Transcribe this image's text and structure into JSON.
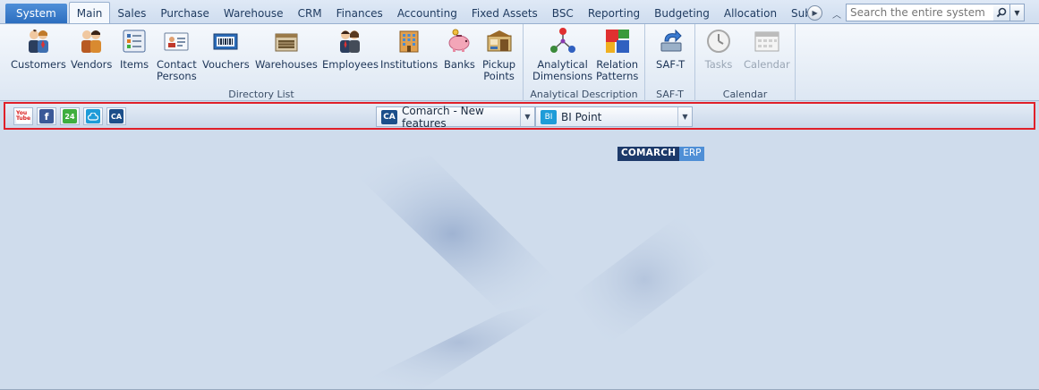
{
  "tabs": [
    {
      "label": "System",
      "kind": "system"
    },
    {
      "label": "Main",
      "kind": "active"
    },
    {
      "label": "Sales"
    },
    {
      "label": "Purchase"
    },
    {
      "label": "Warehouse"
    },
    {
      "label": "CRM"
    },
    {
      "label": "Finances"
    },
    {
      "label": "Accounting"
    },
    {
      "label": "Fixed Assets"
    },
    {
      "label": "BSC"
    },
    {
      "label": "Reporting"
    },
    {
      "label": "Budgeting"
    },
    {
      "label": "Allocation"
    },
    {
      "label": "Sub"
    }
  ],
  "search": {
    "placeholder": "Search the entire system"
  },
  "help_label": "?",
  "ribbon": {
    "directory": {
      "label": "Directory List",
      "buttons": [
        "Customers",
        "Vendors",
        "Items",
        "Contact\nPersons",
        "Vouchers",
        "Warehouses",
        "Employees",
        "Institutions",
        "Banks",
        "Pickup\nPoints"
      ]
    },
    "analytical": {
      "label": "Analytical Description",
      "buttons": [
        "Analytical\nDimensions",
        "Relation\nPatterns"
      ]
    },
    "saft": {
      "label": "SAF-T",
      "buttons": [
        "SAF-T"
      ]
    },
    "calendar": {
      "label": "Calendar",
      "buttons": [
        "Tasks",
        "Calendar"
      ]
    }
  },
  "quick": {
    "icons": [
      {
        "name": "youtube",
        "text": "You Tube",
        "color": "#d81e1e"
      },
      {
        "name": "facebook",
        "text": "f",
        "color": "#3b5998"
      },
      {
        "name": "comarch24",
        "text": "24",
        "color": "#3fae3f"
      },
      {
        "name": "cloud",
        "text": "",
        "color": "#1e9cd8"
      },
      {
        "name": "ca",
        "text": "CA",
        "color": "#1c4f8a"
      }
    ],
    "combo1": {
      "badge": "CA",
      "text": "Comarch - New features"
    },
    "combo2": {
      "badge": "BI",
      "text": "BI Point"
    }
  },
  "logo": {
    "part1": "COMARCH",
    "part2": "ERP"
  },
  "colors": {
    "accent": "#2c6ebf",
    "highlight_border": "#e0202a"
  }
}
